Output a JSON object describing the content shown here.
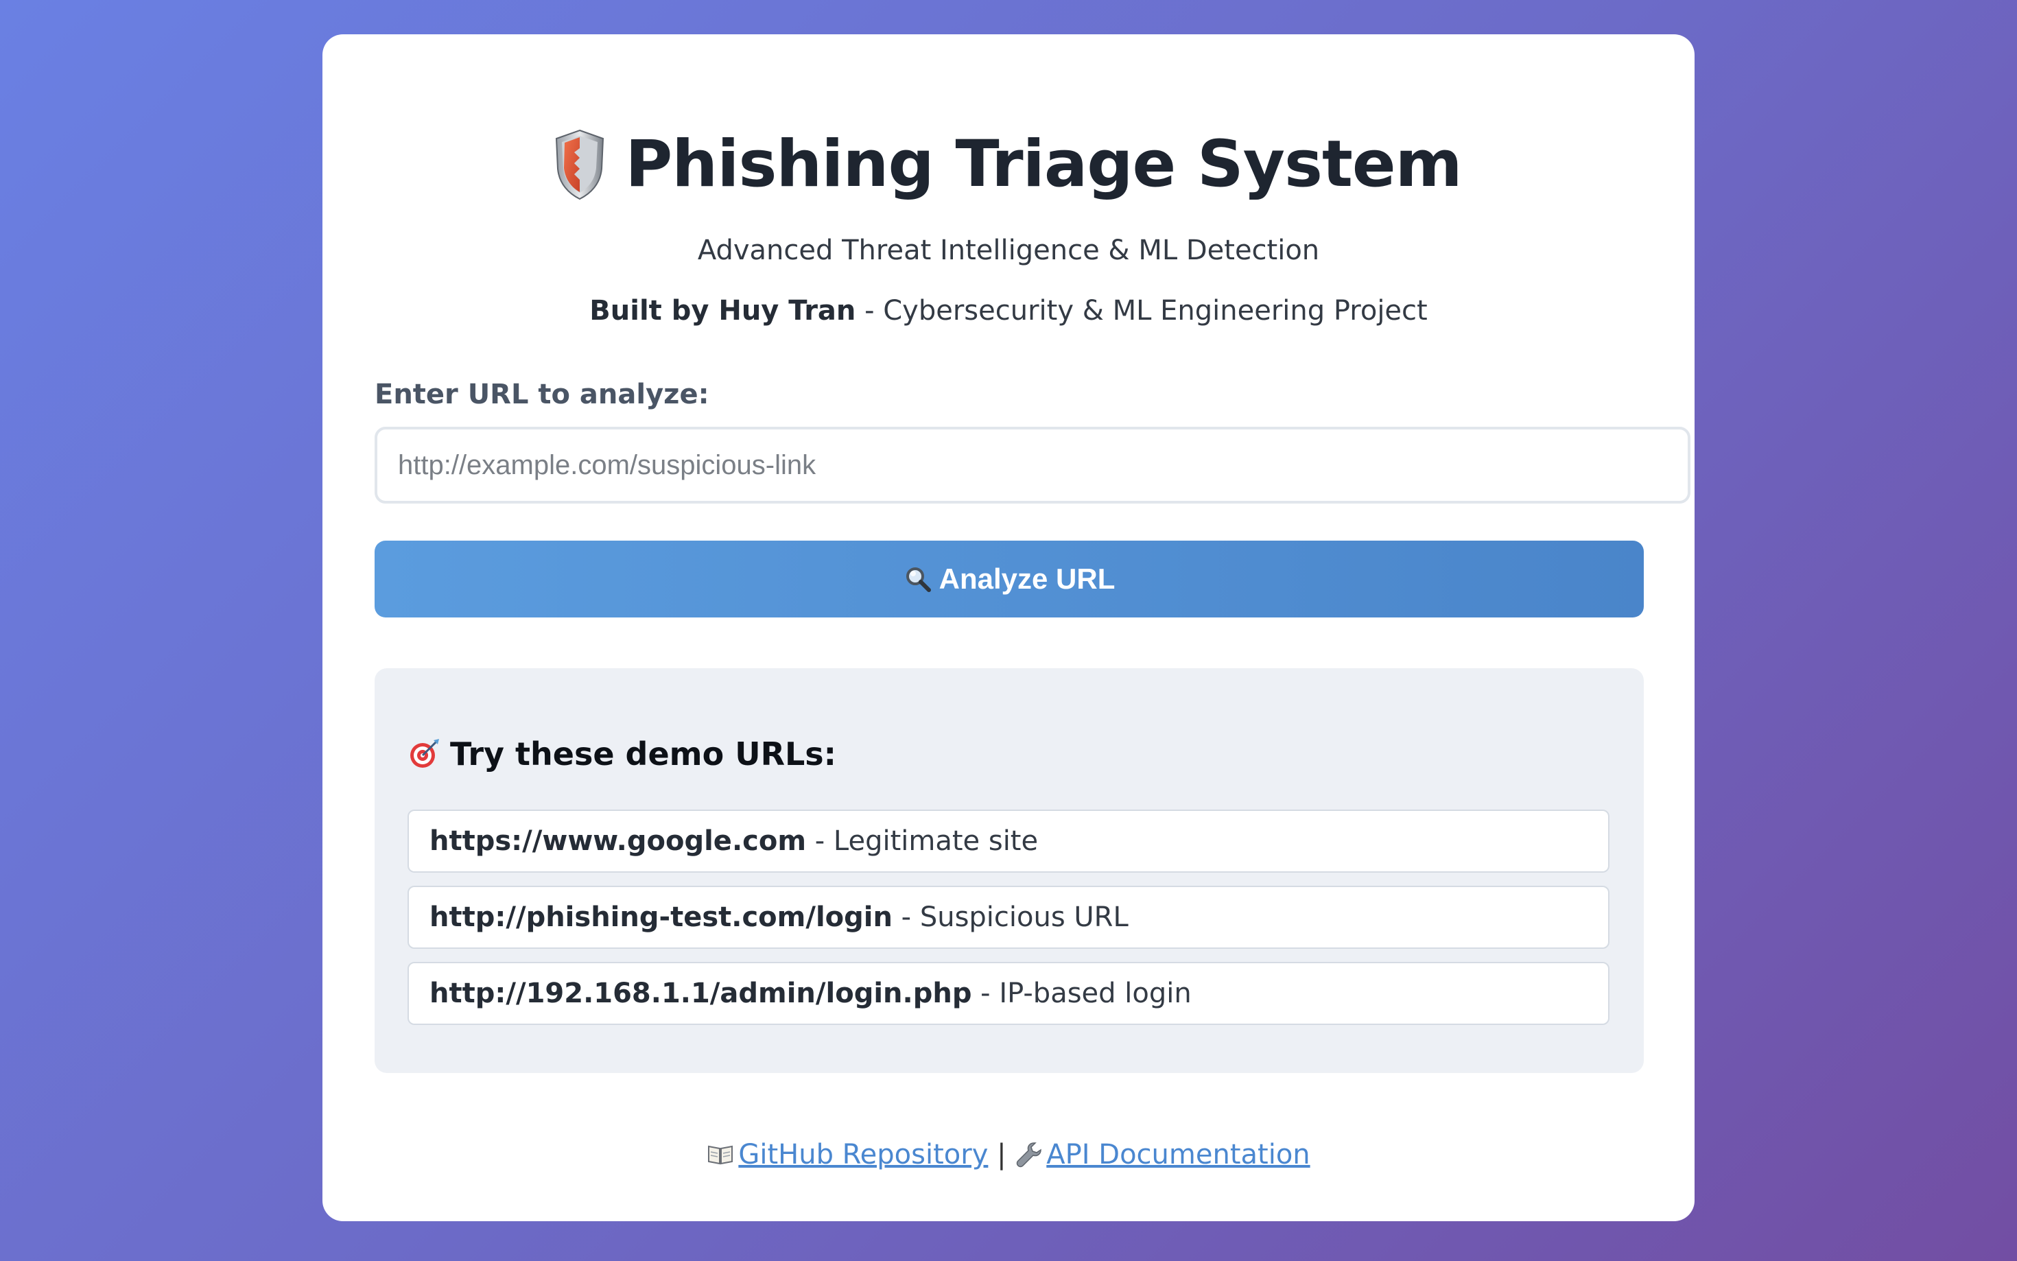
{
  "header": {
    "title": "Phishing Triage System",
    "subtitle": "Advanced Threat Intelligence & ML Detection",
    "byline_bold": "Built by Huy Tran",
    "byline_rest": " - Cybersecurity & ML Engineering Project"
  },
  "form": {
    "label": "Enter URL to analyze:",
    "placeholder": "http://example.com/suspicious-link",
    "value": "",
    "button_label": "Analyze URL"
  },
  "demo": {
    "heading": "Try these demo URLs:",
    "items": [
      {
        "url": "https://www.google.com",
        "desc": " - Legitimate site"
      },
      {
        "url": "http://phishing-test.com/login",
        "desc": " - Suspicious URL"
      },
      {
        "url": "http://192.168.1.1/admin/login.php",
        "desc": " - IP-based login"
      }
    ]
  },
  "footer": {
    "github_label": "GitHub Repository",
    "separator": " | ",
    "api_label": "API Documentation"
  },
  "icons": {
    "title": "shield-icon",
    "button": "magnifier-icon",
    "demo_heading": "target-icon",
    "github": "book-icon",
    "api": "wrench-icon"
  },
  "colors": {
    "background_start": "#6a80e3",
    "background_end": "#724ea3",
    "button": "#4f8fd4",
    "link": "#4a87d0",
    "demo_panel": "#edf0f5"
  }
}
